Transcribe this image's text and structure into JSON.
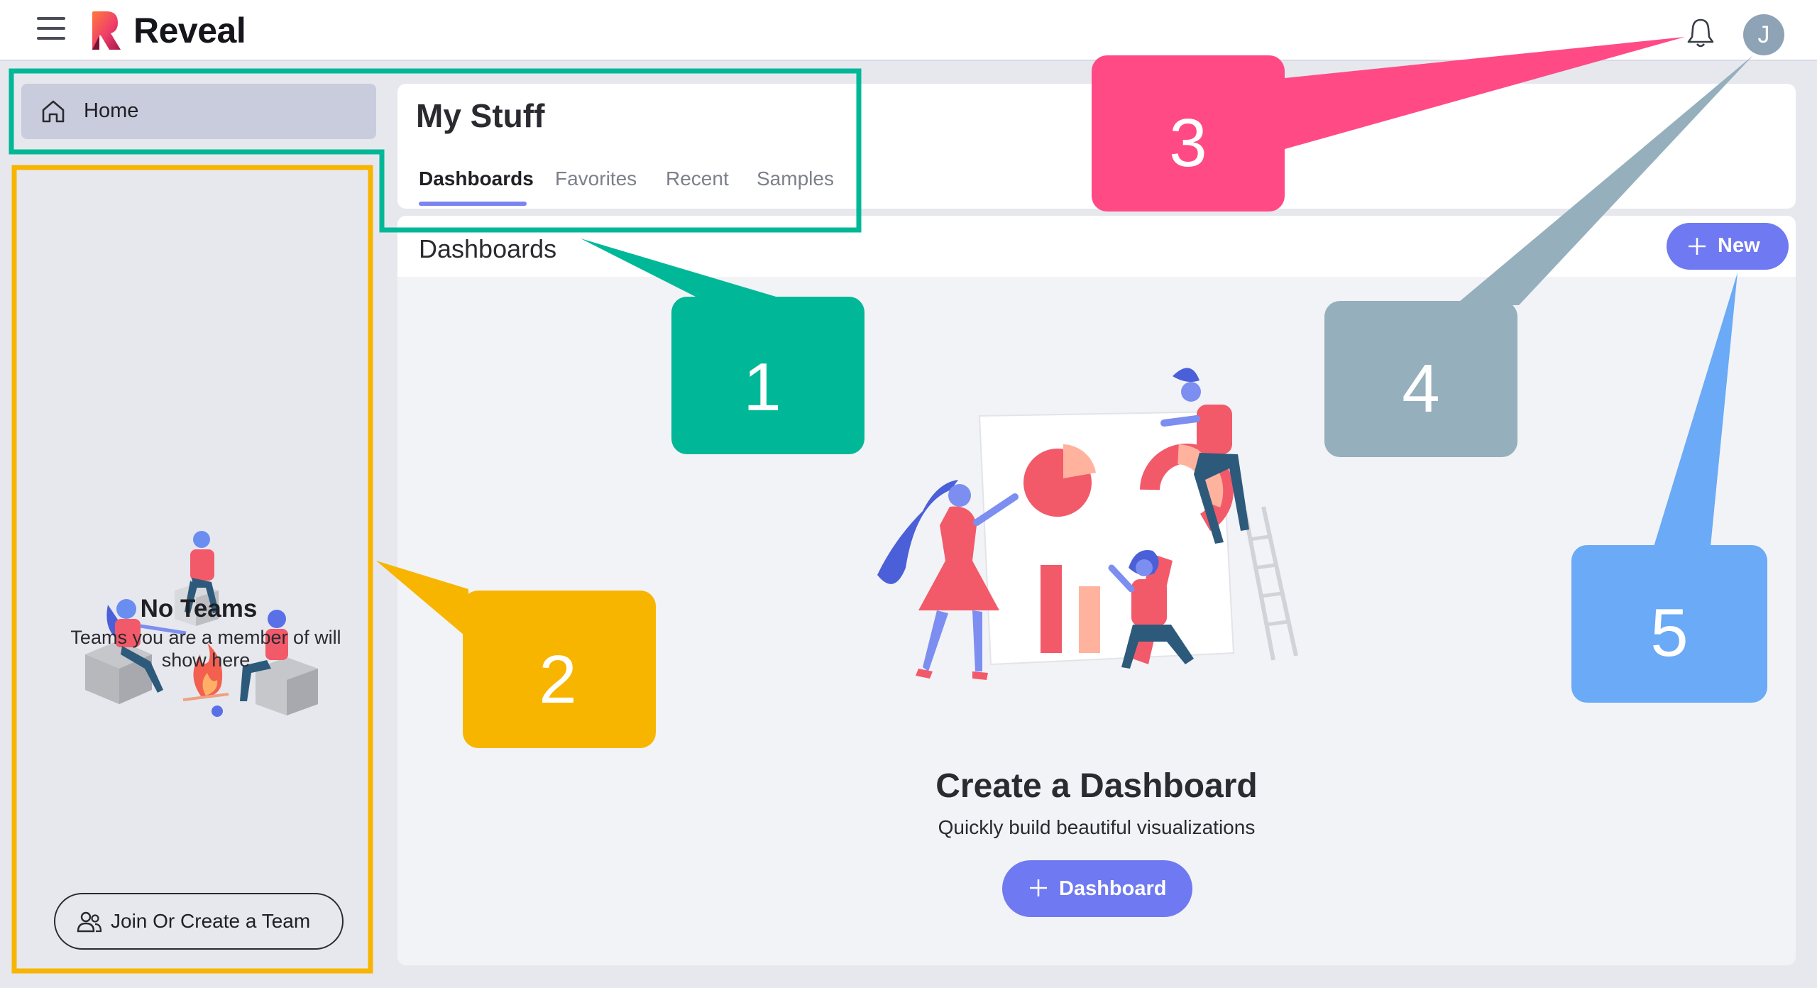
{
  "app": {
    "name": "Reveal",
    "avatar_initial": "J"
  },
  "sidebar": {
    "home_label": "Home",
    "teams": {
      "title": "No Teams",
      "subtitle": "Teams you are a member of will show here",
      "join_button": "Join Or Create a Team"
    }
  },
  "header": {
    "title": "My Stuff",
    "tabs": [
      {
        "label": "Dashboards",
        "active": true
      },
      {
        "label": "Favorites",
        "active": false
      },
      {
        "label": "Recent",
        "active": false
      },
      {
        "label": "Samples",
        "active": false
      }
    ]
  },
  "main": {
    "section_title": "Dashboards",
    "new_button": "New",
    "empty_state": {
      "title": "Create a Dashboard",
      "subtitle": "Quickly build beautiful visualizations",
      "button": "Dashboard"
    }
  },
  "callouts": [
    {
      "number": "1",
      "color": "#00b897"
    },
    {
      "number": "2",
      "color": "#f7b500"
    },
    {
      "number": "3",
      "color": "#ff4a86"
    },
    {
      "number": "4",
      "color": "#95afbd"
    },
    {
      "number": "5",
      "color": "#6aaaf6"
    }
  ],
  "colors": {
    "accent": "#6f79f2",
    "tab_underline": "#7b84f0",
    "home_active_bg": "#c8ccdc",
    "background": "#e6e8ee"
  }
}
